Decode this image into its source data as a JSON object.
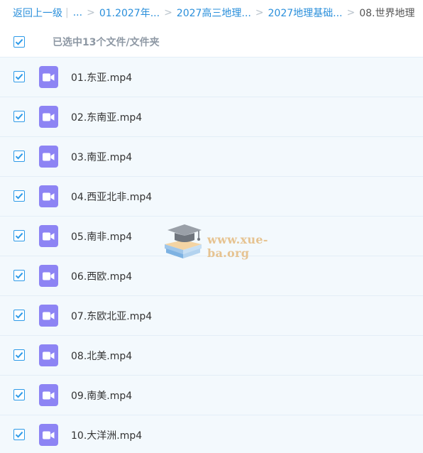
{
  "breadcrumb": {
    "back_label": "返回上一级",
    "pipe": "|",
    "ellipsis": "...",
    "sep": ">",
    "items": [
      "01.2027年...",
      "2027高三地理...",
      "2027地理基础..."
    ],
    "current": "08.世界地理"
  },
  "selection": {
    "status": "已选中13个文件/文件夹",
    "all_checked": true
  },
  "files": [
    {
      "name": "01.东亚.mp4",
      "checked": true
    },
    {
      "name": "02.东南亚.mp4",
      "checked": true
    },
    {
      "name": "03.南亚.mp4",
      "checked": true
    },
    {
      "name": "04.西亚北非.mp4",
      "checked": true
    },
    {
      "name": "05.南非.mp4",
      "checked": true
    },
    {
      "name": "06.西欧.mp4",
      "checked": true
    },
    {
      "name": "07.东欧北亚.mp4",
      "checked": true
    },
    {
      "name": "08.北美.mp4",
      "checked": true
    },
    {
      "name": "09.南美.mp4",
      "checked": true
    },
    {
      "name": "10.大洋洲.mp4",
      "checked": true
    }
  ],
  "file_icon": "video-file-icon",
  "watermark": {
    "text": "www.xue-ba.org",
    "icon": "graduation-cap-books-icon"
  },
  "colors": {
    "link": "#2a8fdb",
    "checkbox": "#2d9ae8",
    "row_bg": "#f3f9fd",
    "video_icon": "#8d84f4",
    "watermark_text": "#e6c391"
  }
}
